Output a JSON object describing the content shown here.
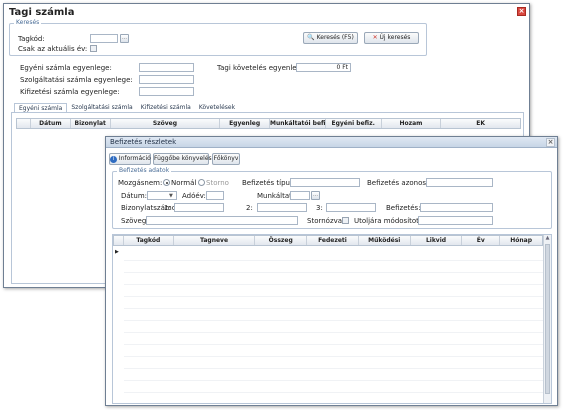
{
  "main_window": {
    "title": "Tagi számla",
    "search_legend": "Keresés",
    "member_id_label": "Tagkód:",
    "only_current_year_label": "Csak az aktuális év:",
    "search_fs_button": "Keresés (F5)",
    "new_search_button": "Új keresés",
    "individual_balance_label": "Egyéni számla egyenlege:",
    "service_balance_label": "Szolgáltatási számla egyenlege:",
    "payout_balance_label": "Kifizetési számla egyenlege:",
    "member_claims_label": "Tagi követelés egyenlege:",
    "member_claims_value": "0 Ft",
    "tabs": [
      "Egyéni számla",
      "Szolgáltatási számla",
      "Kifizetési számla",
      "Követelések"
    ],
    "grid_columns": [
      "Dátum",
      "Bizonylat",
      "Szöveg",
      "Egyenleg",
      "Munkáltatói befiz.",
      "Egyéni befiz.",
      "Hozam",
      "EK"
    ]
  },
  "detail_window": {
    "title": "Befizetés részletek",
    "toolbar": [
      "Információ",
      "Függőbe könyvelés",
      "Főkönyv"
    ],
    "legend": "Befizetés adatok",
    "movement_label": "Mozgásnem:",
    "radio_normal": "Normál",
    "radio_storno": "Storno",
    "payment_type_label": "Befizetés típusa:",
    "payment_type_value": "",
    "payment_id_label": "Befizetés azonosító:",
    "date_label": "Dátum:",
    "tax_year_label": "Adóév:",
    "employer_label": "Munkáltató:",
    "voucher_label": "Bizonylatszámok:",
    "voucher_1": "1:",
    "voucher_2": "2:",
    "voucher_3": "3:",
    "payment_label": "Befizetés:",
    "text_label": "Szöveg:",
    "text_value": "",
    "storno_label": "Stornózva:",
    "last_modified_label": "Utoljára módosította:",
    "last_modified_value": "",
    "grid_columns": [
      "Tagkód",
      "Tagneve",
      "Összeg",
      "Fedezeti",
      "Működési",
      "Likvid",
      "Év",
      "Hónap"
    ]
  }
}
